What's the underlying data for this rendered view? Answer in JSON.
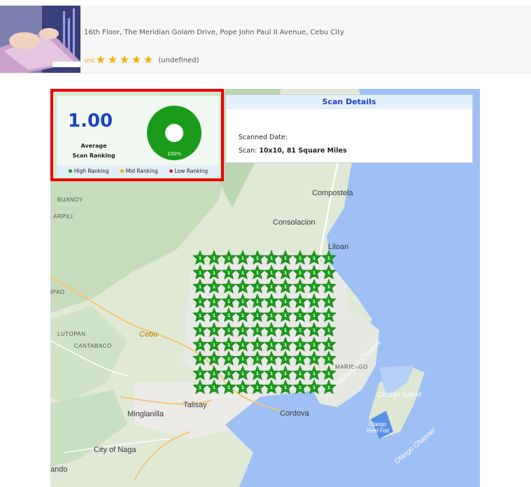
{
  "listing": {
    "address": "16th Floor, The Meridian Golam Drive, Pope John Paul II Avenue, Cebu City",
    "rating_prefix": "unc",
    "stars": 5,
    "rating_count": "(undefined)"
  },
  "summary": {
    "average_value": "1.00",
    "average_label_line1": "Average",
    "average_label_line2": "Scan Ranking",
    "donut_percent_label": "100%",
    "donut_fraction": 1.0,
    "legend": [
      {
        "label": "High Ranking",
        "color": "#1a9c1a"
      },
      {
        "label": "Mid Ranking",
        "color": "#e8b400"
      },
      {
        "label": "Low Ranking",
        "color": "#e02020"
      }
    ]
  },
  "scan_details": {
    "title": "Scan Details",
    "scanned_date_label": "Scanned Date:",
    "scan_label": "Scan:",
    "scan_value": "10x10, 81 Square Miles"
  },
  "map": {
    "labels": {
      "compostela": "Compostela",
      "consolacion": "Consolacion",
      "liloan": "Liloan",
      "buanoy": "BUANOY",
      "arpili": "ARPILI",
      "ipao": "IPAO",
      "lutopan": "LUTOPAN",
      "cantabaco": "CANTABACO",
      "cebu": "Cebu",
      "maribago": "MARIBAGO",
      "hilutungan": "Hilutungan Channel",
      "olango_island": "Olango Island",
      "olango_reef": "Olango Reef Flat",
      "olango_channel": "Olango Channel",
      "talisay": "Talisay",
      "minglanilla": "Minglanilla",
      "cordova": "Cordova",
      "city_of_naga": "City of Naga",
      "ando": "ando"
    },
    "grid_rows": 10,
    "grid_cols": 10,
    "pin_rank": "1",
    "pin_color": "#1a9c1a"
  }
}
